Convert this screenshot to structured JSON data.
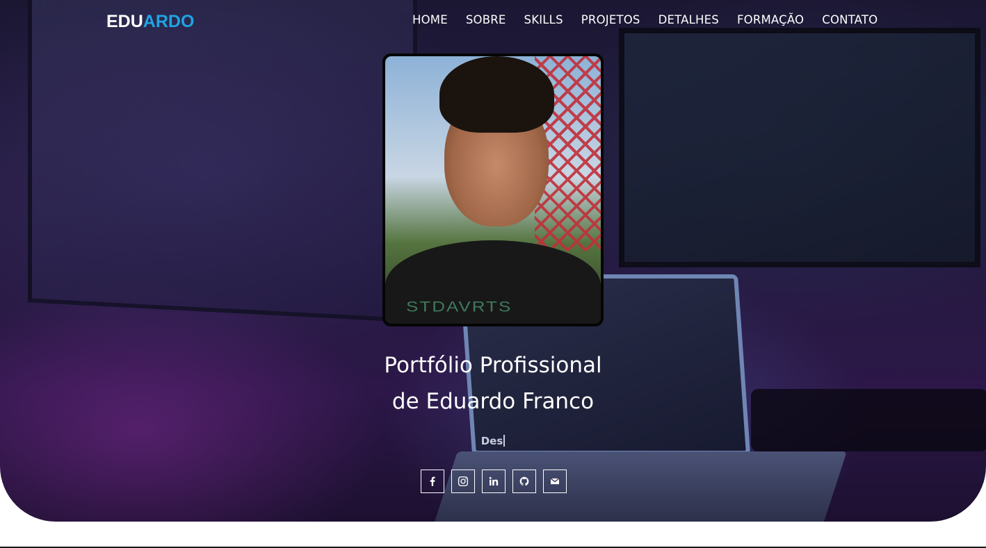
{
  "navbar": {
    "logo_part1": "EDU",
    "logo_part2": "ARDO",
    "links": [
      "HOME",
      "SOBRE",
      "SKILLS",
      "PROJETOS",
      "DETALHES",
      "FORMAÇÃO",
      "CONTATO"
    ]
  },
  "hero": {
    "title_line1": "Portfólio Profissional",
    "title_line2": "de Eduardo Franco",
    "typed_text": "Des",
    "photo_shirt_text": "STDAVRTS"
  },
  "socials": [
    {
      "icon": "facebook-icon"
    },
    {
      "icon": "instagram-icon"
    },
    {
      "icon": "linkedin-icon"
    },
    {
      "icon": "github-icon"
    },
    {
      "icon": "email-icon"
    }
  ],
  "colors": {
    "logo_accent": "#1fa4e2",
    "text": "#ffffff",
    "background": "#1b1733"
  }
}
